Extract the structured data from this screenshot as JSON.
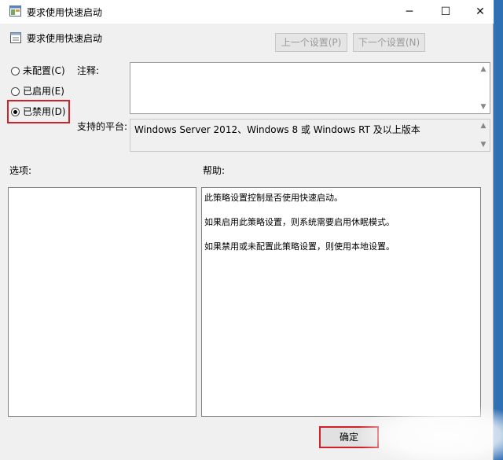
{
  "window": {
    "title": "要求使用快速启动",
    "minimize_glyph": "─",
    "maximize_glyph": "☐",
    "close_glyph": "✕"
  },
  "header": {
    "policy_name": "要求使用快速启动",
    "prev_setting": "上一个设置(P)",
    "next_setting": "下一个设置(N)"
  },
  "state_options": [
    {
      "label": "未配置(C)",
      "checked": false
    },
    {
      "label": "已启用(E)",
      "checked": false
    },
    {
      "label": "已禁用(D)",
      "checked": true
    }
  ],
  "comment": {
    "label": "注释:",
    "value": ""
  },
  "platform": {
    "label": "支持的平台:",
    "value": "Windows Server 2012、Windows 8 或 Windows RT 及以上版本"
  },
  "options_pane": {
    "label": "选项:"
  },
  "help_pane": {
    "label": "帮助:",
    "lines": [
      "此策略设置控制是否使用快速启动。",
      "如果启用此策略设置，则系统需要启用休眠模式。",
      "如果禁用或未配置此策略设置，则使用本地设置。"
    ]
  },
  "footer": {
    "ok_label": "确定"
  },
  "icons": {
    "app": "group-policy-icon",
    "setting": "policy-setting-icon"
  },
  "colors": {
    "highlight_box": "#d0202a",
    "desktop": "#3a7fc4"
  }
}
